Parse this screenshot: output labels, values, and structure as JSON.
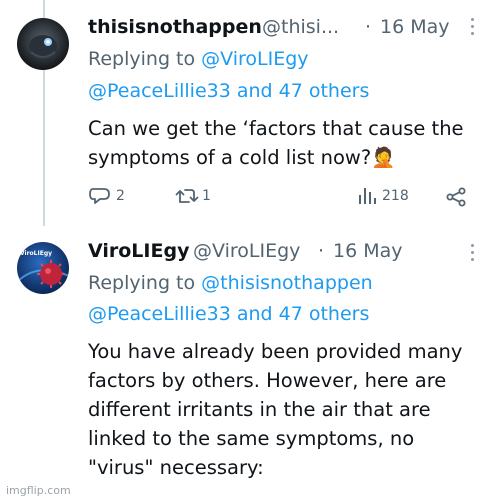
{
  "tweets": [
    {
      "display_name": "thisisnothappen",
      "handle": "@thisi...",
      "dot": "·",
      "date": "16 May",
      "replying_prefix": "Replying to",
      "mention_1": "@ViroLIEgy",
      "mention_2": "@PeaceLillie33 and 47 others",
      "text_lines": [
        "Can we get the ‘factors that cause the",
        "symptoms of a cold list now?"
      ],
      "emoji": "🤦",
      "reply_count": "2",
      "retweet_count": "1",
      "views": "218",
      "avatar_icon": "dark-robot-avatar-icon"
    },
    {
      "display_name": "ViroLIEgy",
      "handle": "@ViroLIEgy",
      "dot": "·",
      "date": "16 May",
      "replying_prefix": "Replying to",
      "mention_1": "@thisisnothappen",
      "mention_2": "@PeaceLillie33 and 47 others",
      "text_lines": [
        "You have already been provided many",
        "factors by others. However, here are",
        "different irritants in the air that are",
        "linked to the same symptoms, no",
        "\"virus\" necessary:"
      ],
      "avatar_icon": "virus-logo-avatar-icon",
      "avatar_label": "ViroLIEgy"
    }
  ],
  "watermark": "imgflip.com",
  "colors": {
    "link": "#1d9bf0",
    "muted": "#536471",
    "text": "#0f1419",
    "thread_line": "#cfd9de"
  }
}
